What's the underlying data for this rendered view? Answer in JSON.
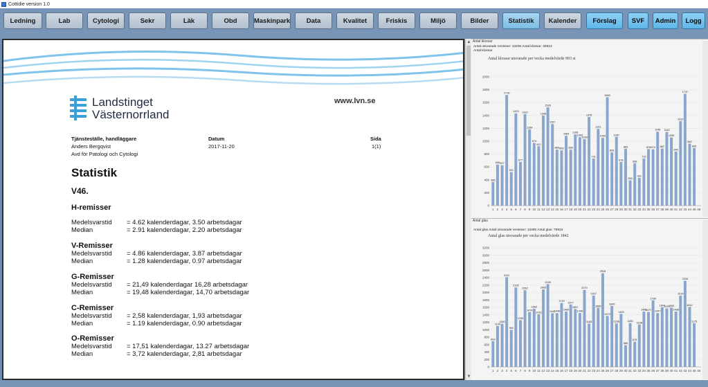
{
  "window": {
    "title": "Cottidie version 1.0"
  },
  "toolbar": {
    "buttons": [
      {
        "label": "Ledning",
        "state": "normal"
      },
      {
        "label": "Lab",
        "state": "normal"
      },
      {
        "label": "Cytologi",
        "state": "normal"
      },
      {
        "label": "Sekr",
        "state": "normal"
      },
      {
        "label": "Läk",
        "state": "normal"
      },
      {
        "label": "Obd",
        "state": "normal"
      },
      {
        "label": "Maskinpark",
        "state": "normal"
      },
      {
        "label": "Data",
        "state": "normal"
      },
      {
        "label": "Kvalitet",
        "state": "normal"
      },
      {
        "label": "Friskis",
        "state": "normal"
      },
      {
        "label": "Miljö",
        "state": "normal"
      },
      {
        "label": "Bilder",
        "state": "normal"
      },
      {
        "label": "Statistik",
        "state": "active"
      },
      {
        "label": "Kalender",
        "state": "normal"
      },
      {
        "label": "Förslag",
        "state": "highlight"
      },
      {
        "label": "SVF",
        "state": "highlight"
      },
      {
        "label": "Admin",
        "state": "highlight"
      },
      {
        "label": "Logg",
        "state": "highlight"
      }
    ]
  },
  "document": {
    "org_name_line1": "Landstinget",
    "org_name_line2": "Västernorrland",
    "website": "www.lvn.se",
    "header_labels": {
      "unit": "Tjänsteställe, handläggare",
      "date": "Datum",
      "page": "Sida"
    },
    "handler_name": "Anders Bergqvist",
    "handler_dept": "Avd för Patologi och Cytologi",
    "date": "2017-11-20",
    "page": "1(1)",
    "title": "Statistik",
    "week": "V46.",
    "sections": [
      {
        "heading": "H-remisser",
        "rows": [
          {
            "label": "Medelsvarstid",
            "value": "= 4.62 kalenderdagar, 3.50 arbetsdagar"
          },
          {
            "label": "Median",
            "value": "= 2.91 kalenderdagar, 2.20 arbetsdagar"
          }
        ]
      },
      {
        "heading": "V-Remisser",
        "rows": [
          {
            "label": "Medelsvarstid",
            "value": "= 4.86 kalenderdagar, 3.87 arbetsdagar"
          },
          {
            "label": "Median",
            "value": "= 1.28 kalenderdagar, 0.97 arbetsdagar"
          }
        ]
      },
      {
        "heading": "G-Remisser",
        "rows": [
          {
            "label": "Medelsvarstid",
            "value": "= 21,49 kalenderdagar 16,28 arbetsdagar"
          },
          {
            "label": "Median",
            "value": "= 19,48 kalenderdagar, 14,70 arbetsdagar"
          }
        ]
      },
      {
        "heading": "C-Remisser",
        "rows": [
          {
            "label": "Medelsvarstid",
            "value": "= 2,58 kalenderdagar, 1,93 arbetsdagar"
          },
          {
            "label": "Median",
            "value": "= 1.19 kalenderdagar, 0.90 arbetsdagar"
          }
        ]
      },
      {
        "heading": "O-Remisser",
        "rows": [
          {
            "label": "Medelsvarstid",
            "value": "= 17,51 kalenderdagar, 13.27 arbetsdagar"
          },
          {
            "label": "Median",
            "value": "= 3,72  kalenderdagar, 2,81 arbetsdagar"
          }
        ]
      }
    ]
  },
  "colors": {
    "bar": "#8aa6cc",
    "toolbar": "#7895b8",
    "active_button": "#7dbde3",
    "highlight_button": "#5fb6e8"
  },
  "chart_data": [
    {
      "type": "bar",
      "tab": "Antal klossar",
      "meta": "Antal utsvarade remisser: 13208  Antal klossar: 45913",
      "y_axis_title": "Antal klossar",
      "title": "Antal klossar utsvarade per vecka medelvärde 993 st",
      "categories": [
        "1",
        "2",
        "3",
        "4",
        "5",
        "6",
        "7",
        "8",
        "9",
        "10",
        "11",
        "12",
        "13",
        "14",
        "15",
        "16",
        "17",
        "18",
        "19",
        "20",
        "21",
        "22",
        "23",
        "24",
        "25",
        "26",
        "27",
        "28",
        "29",
        "30",
        "31",
        "32",
        "33",
        "34",
        "35",
        "36",
        "37",
        "38",
        "39",
        "40",
        "41",
        "42",
        "43",
        "44",
        "45",
        "46"
      ],
      "values": [
        366,
        639,
        627,
        1718,
        521,
        1433,
        677,
        1422,
        1184,
        974,
        922,
        1398,
        1526,
        1267,
        869,
        859,
        1084,
        869,
        1106,
        1063,
        1033,
        1376,
        731,
        1191,
        1052,
        1683,
        826,
        1067,
        678,
        883,
        393,
        658,
        431,
        732,
        878,
        874,
        1148,
        887,
        1143,
        1059,
        840,
        1312,
        1737,
        962,
        895
      ],
      "ylim": [
        0,
        2000
      ],
      "yticks": [
        0,
        200,
        400,
        600,
        800,
        1000,
        1200,
        1400,
        1600,
        1800,
        2000
      ]
    },
    {
      "type": "bar",
      "tab": "Antal glas",
      "meta": "Antal glas  Antal utsvarade remisser: 13280  Antal glas: 79934",
      "title": "Antal glas utsvarade per vecka medelvärde 1842",
      "categories": [
        "1",
        "2",
        "3",
        "4",
        "5",
        "6",
        "7",
        "8",
        "9",
        "10",
        "11",
        "12",
        "13",
        "14",
        "15",
        "16",
        "17",
        "18",
        "19",
        "20",
        "21",
        "22",
        "23",
        "24",
        "25",
        "26",
        "27",
        "28",
        "29",
        "30",
        "31",
        "32",
        "33",
        "34",
        "35",
        "36",
        "37",
        "38",
        "39",
        "40",
        "41",
        "42",
        "43",
        "44",
        "45",
        "46"
      ],
      "values": [
        693,
        1100,
        1160,
        2411,
        992,
        2135,
        1259,
        2062,
        1474,
        1562,
        1416,
        2083,
        2226,
        1442,
        1448,
        1719,
        1489,
        1677,
        1557,
        1449,
        2070,
        1163,
        1917,
        1585,
        2518,
        1372,
        1640,
        1168,
        1425,
        585,
        1180,
        678,
        1138,
        1486,
        1477,
        1789,
        1447,
        1604,
        1570,
        1592,
        1488,
        1914,
        2316,
        1612,
        1175
      ],
      "ylim": [
        0,
        3200
      ],
      "yticks": [
        0,
        200,
        400,
        600,
        800,
        1000,
        1200,
        1400,
        1600,
        1800,
        2000,
        2200,
        2400,
        2600,
        2800,
        3000,
        3200
      ]
    }
  ]
}
